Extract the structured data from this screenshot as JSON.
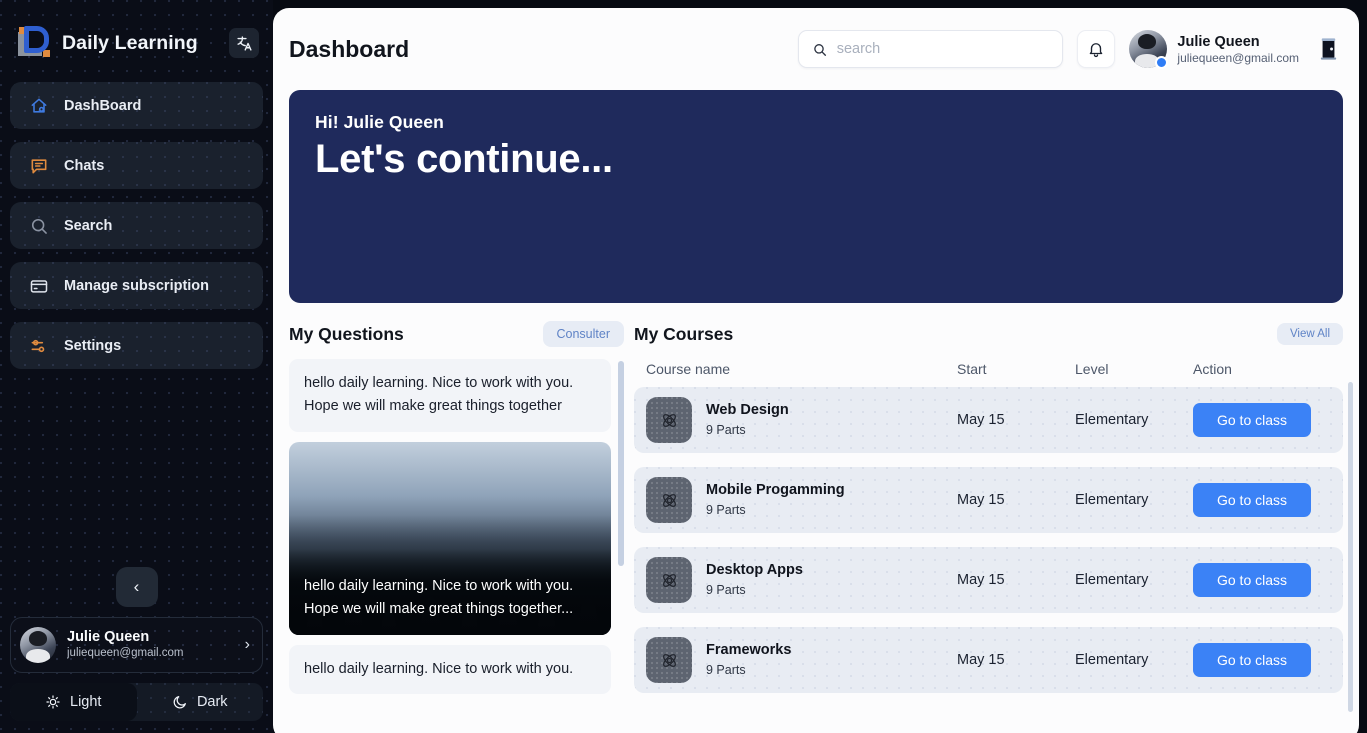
{
  "sidebar": {
    "brand": "Daily Learning",
    "lang_icon": "translate-icon",
    "lang_label": "文A",
    "items": [
      {
        "label": "DashBoard",
        "icon": "home-icon",
        "active": true
      },
      {
        "label": "Chats",
        "icon": "chat-icon",
        "active": false
      },
      {
        "label": "Search",
        "icon": "search-icon",
        "active": false
      },
      {
        "label": "Manage subscription",
        "icon": "credit-card-icon",
        "active": false
      },
      {
        "label": "Settings",
        "icon": "sliders-icon",
        "active": false
      }
    ],
    "collapse_icon": "chevron-left-icon",
    "user": {
      "name": "Julie Queen",
      "email": "juliequeen@gmail.com",
      "arrow_icon": "chevron-right-icon"
    },
    "theme": {
      "light_label": "Light",
      "dark_label": "Dark",
      "light_icon": "sun-icon",
      "dark_icon": "moon-icon",
      "selected": "Light"
    }
  },
  "header": {
    "title": "Dashboard",
    "search": {
      "value": "",
      "placeholder": "search",
      "icon": "search-icon"
    },
    "bell_icon": "bell-icon",
    "user": {
      "name": "Julie Queen",
      "email": "juliequeen@gmail.com",
      "status": "online"
    },
    "logout_icon": "door-icon"
  },
  "hero": {
    "greeting": "Hi! Julie Queen",
    "headline": "Let's continue...",
    "bg_color": "#1f2a5c"
  },
  "questions": {
    "title": "My Questions",
    "action_label": "Consulter",
    "items": [
      {
        "text": "hello daily learning. Nice to work with you. Hope we will make great things together",
        "has_image": false
      },
      {
        "text": "hello daily learning. Nice to work with you. Hope we will make great things together...",
        "has_image": true
      },
      {
        "text": "hello daily learning. Nice to work with you.",
        "has_image": false
      }
    ]
  },
  "courses": {
    "title": "My Courses",
    "action_label": "View All",
    "columns": [
      "Course name",
      "Start",
      "Level",
      "Action"
    ],
    "rows": [
      {
        "name": "Web Design",
        "parts": "9 Parts",
        "start": "May 15",
        "level": "Elementary",
        "action": "Go to class",
        "icon": "atom-icon"
      },
      {
        "name": "Mobile Progamming",
        "parts": "9 Parts",
        "start": "May 15",
        "level": "Elementary",
        "action": "Go to class",
        "icon": "atom-icon"
      },
      {
        "name": "Desktop Apps",
        "parts": "9 Parts",
        "start": "May 15",
        "level": "Elementary",
        "action": "Go to class",
        "icon": "atom-icon"
      },
      {
        "name": "Frameworks",
        "parts": "9 Parts",
        "start": "May 15",
        "level": "Elementary",
        "action": "Go to class",
        "icon": "atom-icon"
      }
    ]
  },
  "colors": {
    "accent": "#3b82f6",
    "navy": "#1f2a5c",
    "sidebar": "#0a0d17",
    "pill": "#e7ecf5"
  }
}
